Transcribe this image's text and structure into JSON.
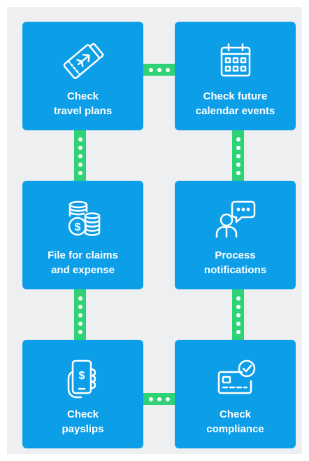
{
  "cards": [
    {
      "label": "Check\ntravel plans",
      "icon": "plane-tickets-icon"
    },
    {
      "label": "Check future\ncalendar events",
      "icon": "calendar-icon"
    },
    {
      "label": "File for claims\nand expense",
      "icon": "coins-icon"
    },
    {
      "label": "Process\nnotifications",
      "icon": "person-chat-icon"
    },
    {
      "label": "Check\npayslips",
      "icon": "phone-money-icon"
    },
    {
      "label": "Check\ncompliance",
      "icon": "id-card-check-icon"
    }
  ],
  "colors": {
    "card": "#0d9ee8",
    "connector": "#2fd375",
    "background": "#eeeff1"
  }
}
